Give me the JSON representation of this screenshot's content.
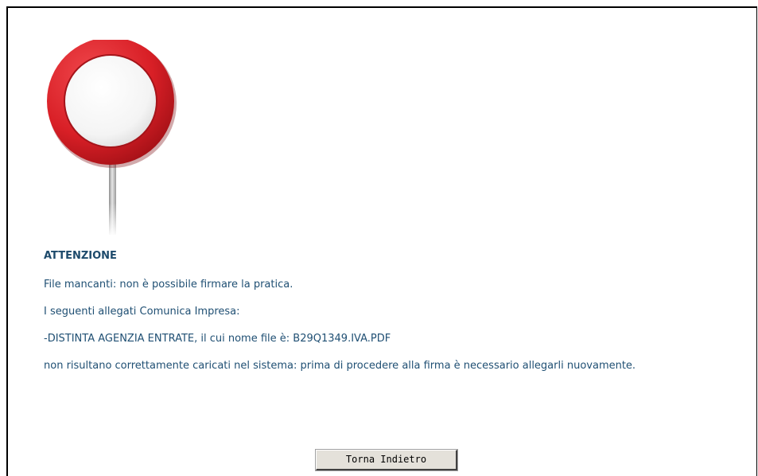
{
  "sign": {
    "icon": "no-entry-sign-icon",
    "ring_color": "#d81f26",
    "pole_color": "#b8b8b8"
  },
  "message": {
    "heading": "ATTENZIONE",
    "line1": "File mancanti: non è possibile firmare la pratica.",
    "line2": "I seguenti allegati Comunica Impresa:",
    "line3": "-DISTINTA AGENZIA ENTRATE, il cui nome file è: B29Q1349.IVA.PDF",
    "line4": "non risultano correttamente caricati nel sistema: prima di procedere alla firma è necessario allegarli nuovamente."
  },
  "actions": {
    "back_label": "Torna Indietro"
  },
  "colors": {
    "text": "#1f4f73",
    "heading": "#1d4a6b",
    "button_bg": "#e4e1da"
  }
}
